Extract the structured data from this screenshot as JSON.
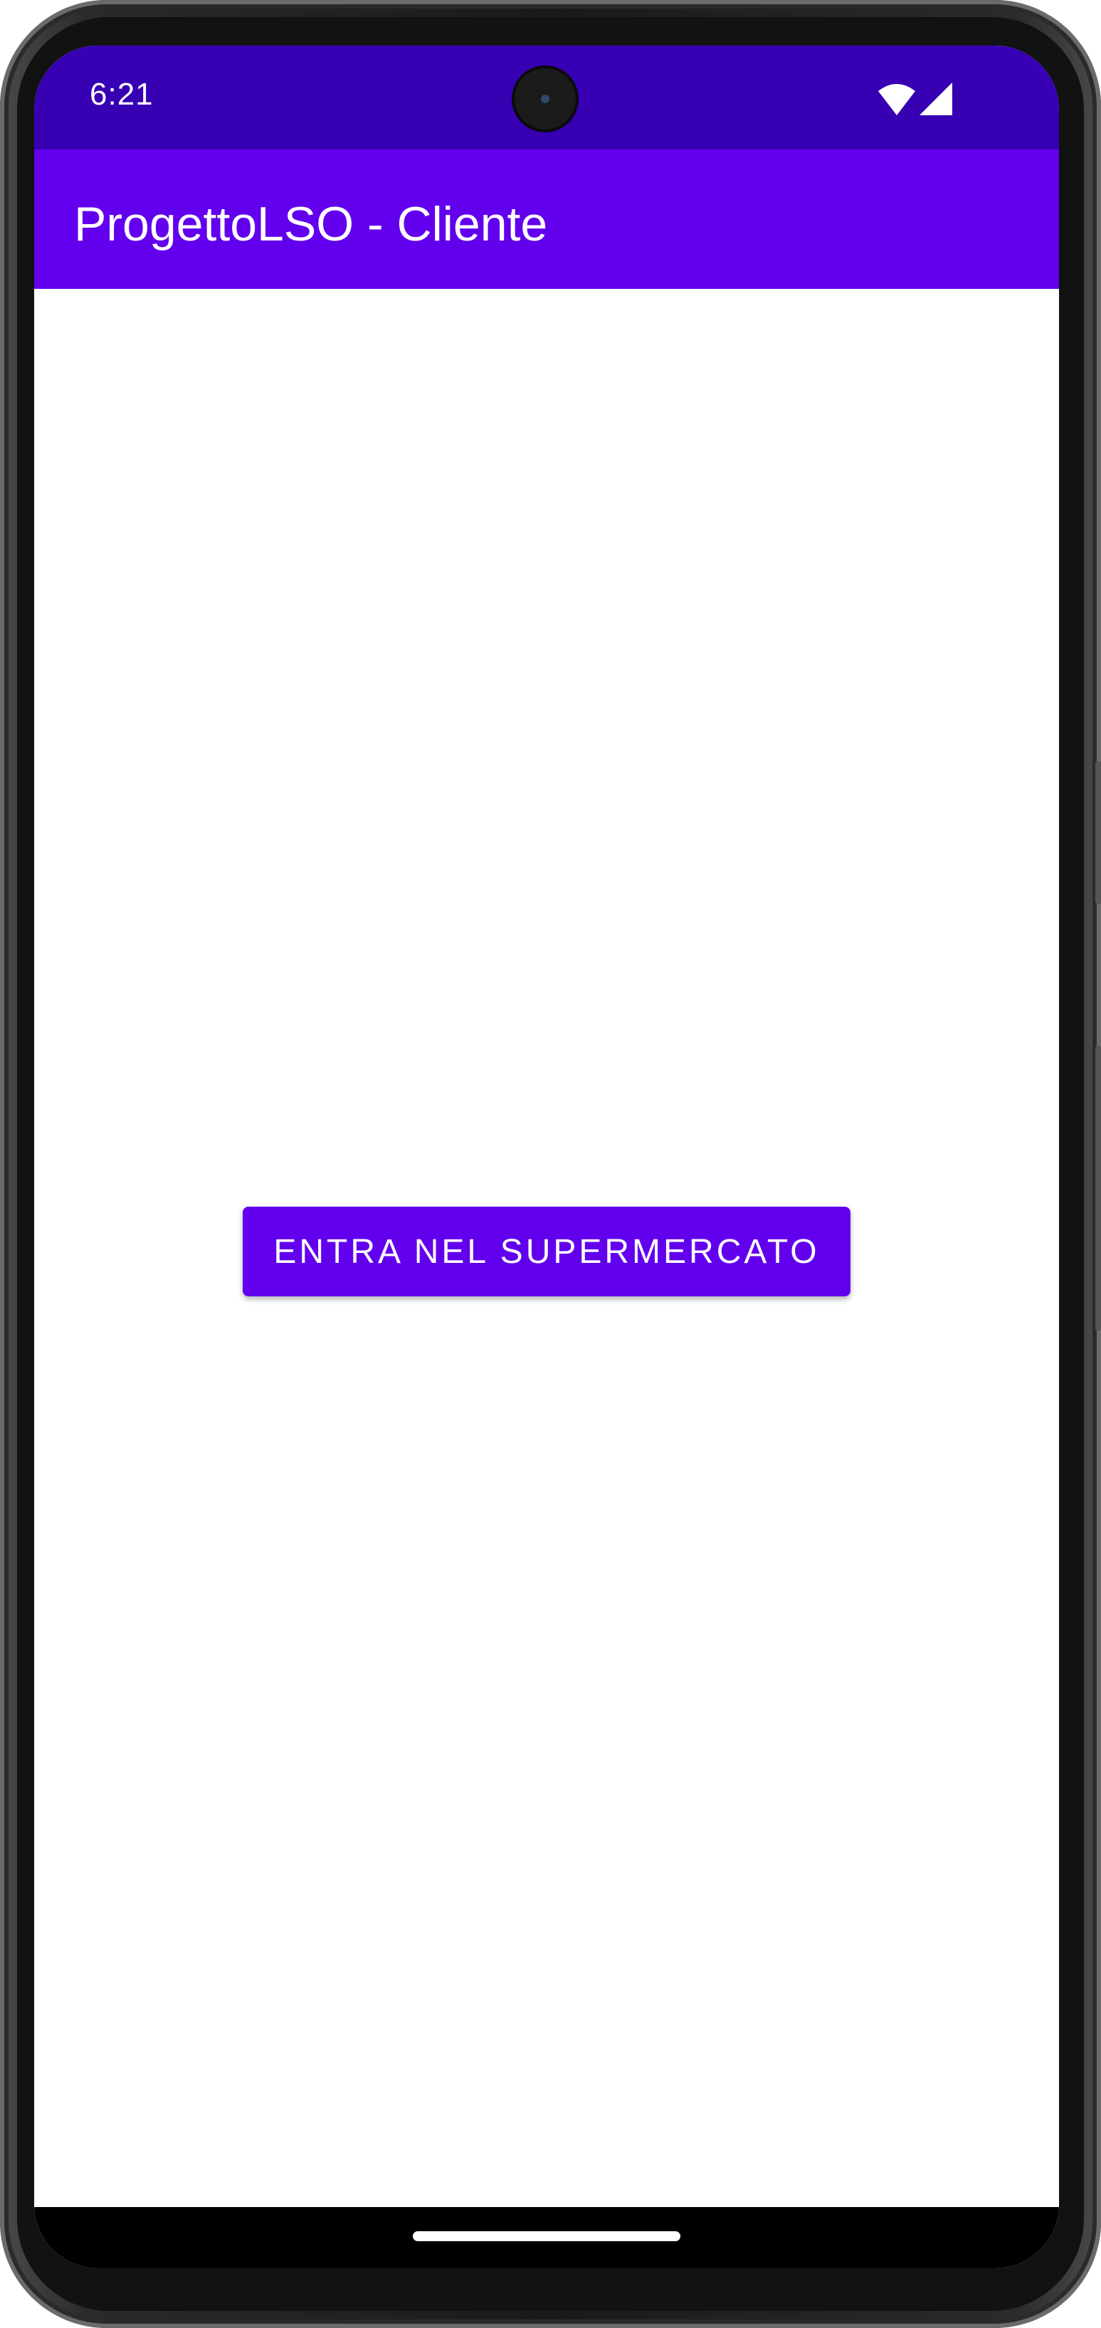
{
  "status_bar": {
    "time": "6:21",
    "icons": [
      "wifi-icon",
      "cellular-signal-icon"
    ],
    "color": "#3700b3"
  },
  "app_bar": {
    "title": "ProgettoLSO - Cliente",
    "color": "#6200ee"
  },
  "main": {
    "enter_button_label": "ENTRA NEL SUPERMERCATO",
    "button_color": "#6200ee"
  }
}
